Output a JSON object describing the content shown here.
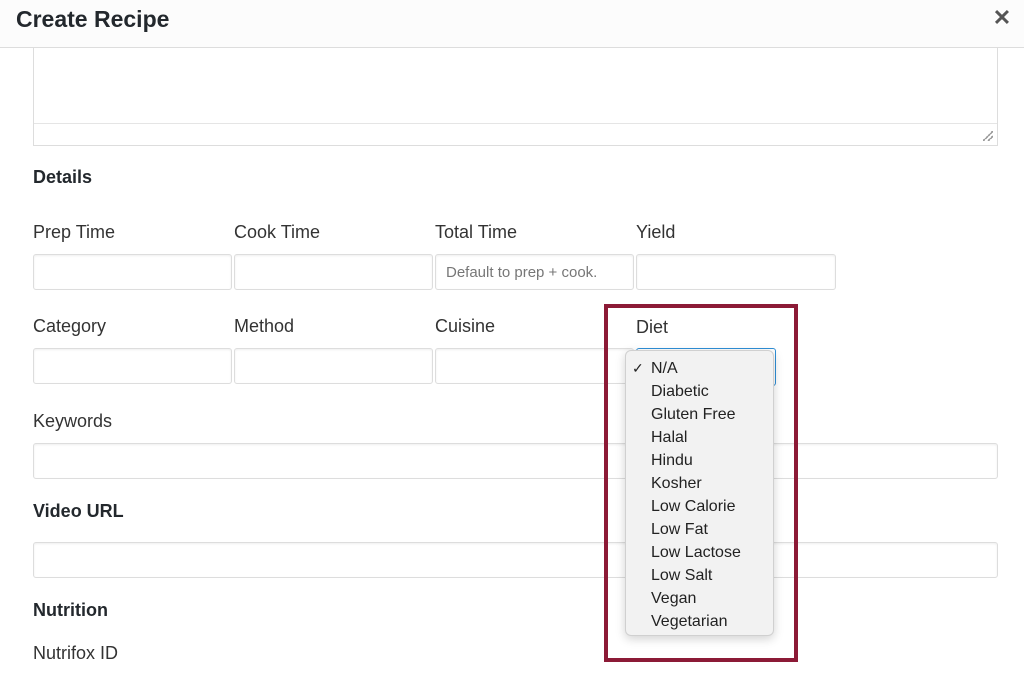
{
  "dialog": {
    "title": "Create Recipe",
    "close_icon": "close-icon"
  },
  "details": {
    "heading": "Details",
    "prep_time": {
      "label": "Prep Time",
      "value": ""
    },
    "cook_time": {
      "label": "Cook Time",
      "value": ""
    },
    "total_time": {
      "label": "Total Time",
      "placeholder": "Default to prep + cook."
    },
    "yield": {
      "label": "Yield",
      "value": ""
    },
    "category": {
      "label": "Category",
      "value": ""
    },
    "method": {
      "label": "Method",
      "value": ""
    },
    "cuisine": {
      "label": "Cuisine",
      "value": ""
    },
    "diet": {
      "label": "Diet",
      "selected": "N/A",
      "options": [
        "N/A",
        "Diabetic",
        "Gluten Free",
        "Halal",
        "Hindu",
        "Kosher",
        "Low Calorie",
        "Low Fat",
        "Low Lactose",
        "Low Salt",
        "Vegan",
        "Vegetarian"
      ]
    },
    "keywords": {
      "label": "Keywords",
      "value": ""
    }
  },
  "video": {
    "heading": "Video URL",
    "value": ""
  },
  "nutrition": {
    "heading": "Nutrition",
    "nutrifox_label": "Nutrifox ID"
  },
  "colors": {
    "highlight": "#8c1a36",
    "focus_border": "#2f8fd6"
  }
}
